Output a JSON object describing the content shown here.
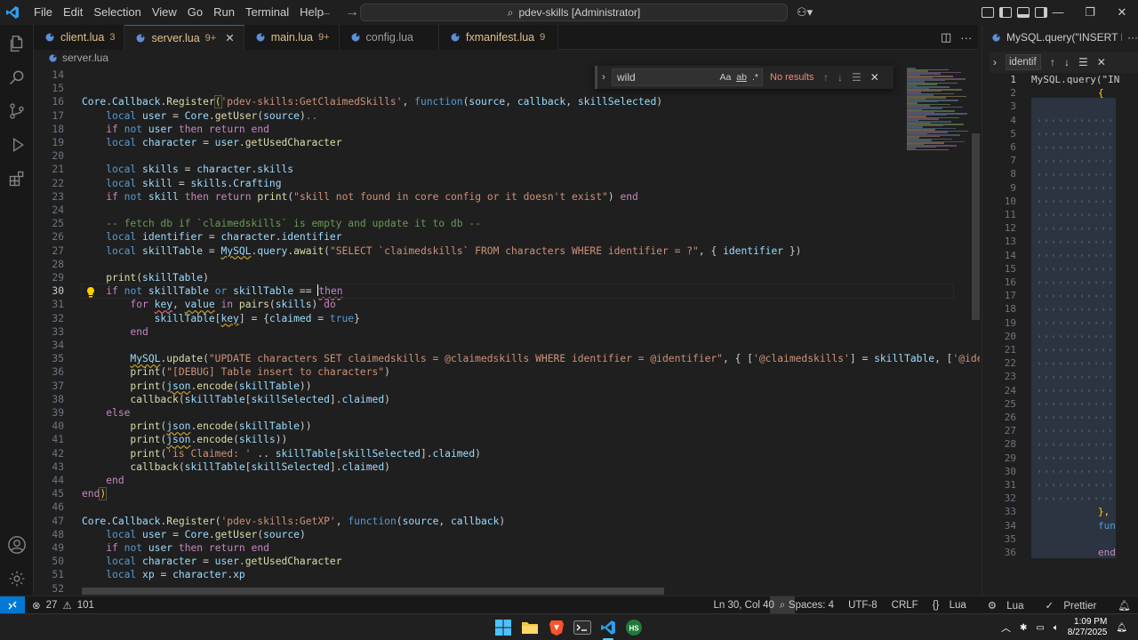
{
  "menu": [
    "File",
    "Edit",
    "Selection",
    "View",
    "Go",
    "Run",
    "Terminal",
    "Help"
  ],
  "command_center": "pdev-skills [Administrator]",
  "tabs": [
    {
      "name": "client.lua",
      "badge": "3",
      "active": false
    },
    {
      "name": "server.lua",
      "badge": "9+",
      "active": true
    },
    {
      "name": "main.lua",
      "badge": "9+",
      "active": false
    },
    {
      "name": "config.lua",
      "badge": "",
      "active": false
    },
    {
      "name": "fxmanifest.lua",
      "badge": "9",
      "active": false
    }
  ],
  "breadcrumb": "server.lua",
  "find": {
    "value": "wild",
    "result": "No results",
    "opt_case": "Aa",
    "opt_word": "ab",
    "opt_regex": ".*"
  },
  "lines": [
    14,
    15,
    16,
    17,
    18,
    19,
    20,
    21,
    22,
    23,
    24,
    25,
    26,
    27,
    28,
    29,
    30,
    31,
    32,
    33,
    34,
    35,
    36,
    37,
    38,
    39,
    40,
    41,
    42,
    43,
    44,
    45,
    46,
    47,
    48,
    49,
    50,
    51,
    52
  ],
  "current_line": 30,
  "side_panel": {
    "tab": "MySQL.query(\"INSERT INTO",
    "find_value": "identif",
    "lines": [
      1,
      2,
      3,
      4,
      5,
      6,
      7,
      8,
      9,
      10,
      11,
      12,
      13,
      14,
      15,
      16,
      17,
      18,
      19,
      20,
      21,
      22,
      23,
      24,
      25,
      26,
      27,
      28,
      29,
      30,
      31,
      32,
      33,
      34,
      35,
      36
    ],
    "code_line1": "MySQL.query(\"IN",
    "code_line2": "{",
    "code_line33": "},",
    "code_line34": "fun",
    "code_line36": "end"
  },
  "status": {
    "errors": "27",
    "warnings": "101",
    "position": "Ln 30, Col 40",
    "spaces": "Spaces: 4",
    "encoding": "UTF-8",
    "eol": "CRLF",
    "language": "Lua",
    "lua_ext": "Lua",
    "prettier": "Prettier"
  },
  "clock": {
    "time": "1:09 PM",
    "date": "8/27/2025"
  },
  "colors": {
    "accent": "#0078d4",
    "keyword": "#c586c0",
    "string": "#ce9178",
    "function": "#dcdcaa",
    "variable": "#9cdcfe",
    "comment": "#6a9955"
  }
}
